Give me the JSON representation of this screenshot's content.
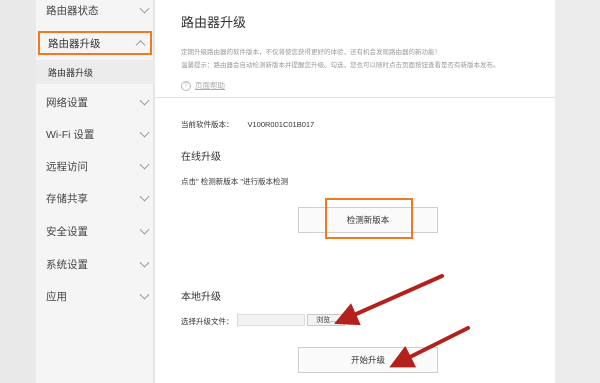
{
  "sidebar": {
    "items": [
      {
        "label": "路由器状态"
      },
      {
        "label": "路由器升级"
      },
      {
        "label": "网络设置"
      },
      {
        "label": "Wi-Fi 设置"
      },
      {
        "label": "远程访问"
      },
      {
        "label": "存储共享"
      },
      {
        "label": "安全设置"
      },
      {
        "label": "系统设置"
      },
      {
        "label": "应用"
      }
    ],
    "sub_item": "路由器升级"
  },
  "main": {
    "title": "路由器升级",
    "desc1": "定期升级路由器的软件版本，不仅将使您获得更好的体验，还有机会发现路由器的新功能！",
    "desc2": "温馨提示：路由器会自动检测新版本并提醒您升级。勾选，您也可以随时点击页面按钮查看是否有新版本发布。",
    "help_link": "页面帮助",
    "current_label": "当前软件版本：",
    "current_version": "V100R001C01B017",
    "online_title": "在线升级",
    "online_hint": "点击\" 检测新版本 \"进行版本检测",
    "check_button": "检测新版本",
    "local_title": "本地升级",
    "file_label": "选择升级文件：",
    "browse_button": "浏览...",
    "start_button": "开始升级"
  },
  "colors": {
    "highlight": "#f07a22",
    "arrow": "#b3211c"
  }
}
